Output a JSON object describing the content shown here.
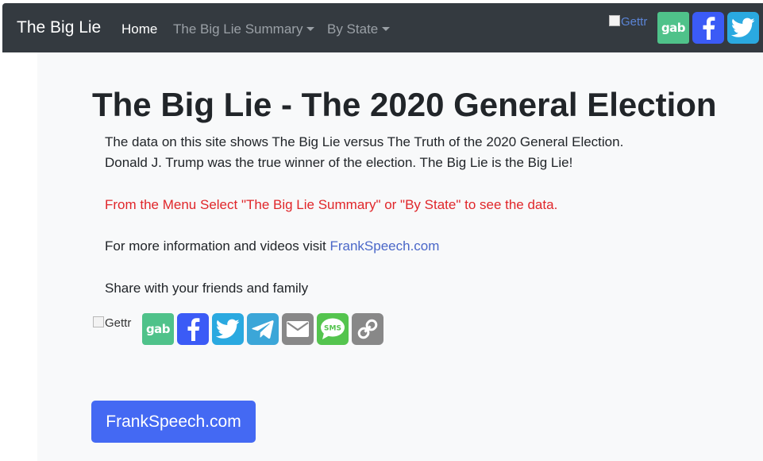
{
  "navbar": {
    "brand": "The Big Lie",
    "links": [
      {
        "label": "Home",
        "active": true
      },
      {
        "label": "The Big Lie Summary",
        "dropdown": true
      },
      {
        "label": "By State",
        "dropdown": true
      }
    ],
    "share": {
      "gettr_alt": "Gettr",
      "gab_label": "gab",
      "icons": [
        "gettr-icon",
        "gab-icon",
        "facebook-icon",
        "twitter-icon"
      ]
    }
  },
  "main": {
    "title": "The Big Lie - The 2020 General Election",
    "intro_line1": "The data on this site shows The Big Lie versus The Truth of the 2020 General Election.",
    "intro_line2": "Donald J. Trump was the true winner of the election. The Big Lie is the Big Lie!",
    "menu_note": "From the Menu Select \"The Big Lie Summary\" or \"By State\" to see the data.",
    "info_prefix": "For more information and videos visit ",
    "info_link": "FrankSpeech.com",
    "share_text": "Share with your friends and family",
    "share_buttons": {
      "gettr_alt": "Gettr",
      "gab_label": "gab",
      "sms_label": "SMS",
      "icons": [
        "gettr-icon",
        "gab-icon",
        "facebook-icon",
        "twitter-icon",
        "telegram-icon",
        "email-icon",
        "sms-icon",
        "link-icon"
      ]
    },
    "button_label": "FrankSpeech.com"
  },
  "colors": {
    "navbar_bg": "#343a40",
    "main_bg": "#f8f9fa",
    "accent_red": "#e0262a",
    "link": "#4a67c8",
    "button": "#4469f3",
    "gab": "#4fc28a",
    "facebook": "#3b5bf6",
    "twitter": "#2aa9e0"
  }
}
